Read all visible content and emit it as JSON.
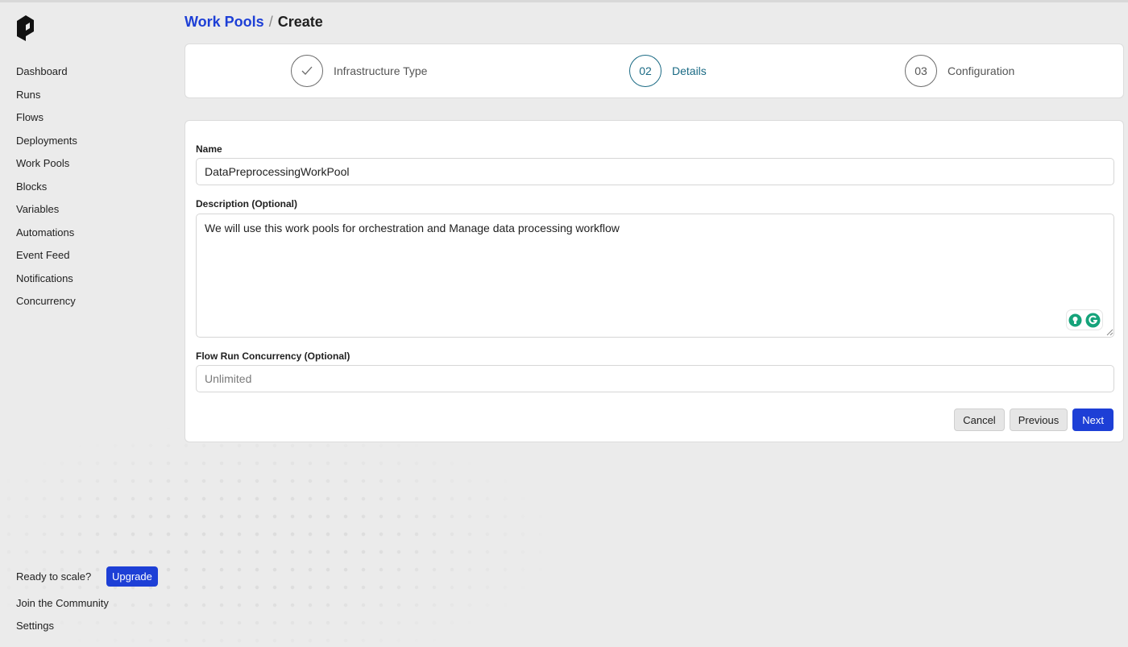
{
  "sidebar": {
    "logo_icon": "prefect-logo-icon",
    "nav_items": [
      {
        "label": "Dashboard"
      },
      {
        "label": "Runs"
      },
      {
        "label": "Flows"
      },
      {
        "label": "Deployments"
      },
      {
        "label": "Work Pools"
      },
      {
        "label": "Blocks"
      },
      {
        "label": "Variables"
      },
      {
        "label": "Automations"
      },
      {
        "label": "Event Feed"
      },
      {
        "label": "Notifications"
      },
      {
        "label": "Concurrency"
      }
    ],
    "ready_text": "Ready to scale?",
    "upgrade_label": "Upgrade",
    "community_label": "Join the Community",
    "settings_label": "Settings"
  },
  "breadcrumb": {
    "parent": "Work Pools",
    "separator": "/",
    "current": "Create"
  },
  "stepper": {
    "steps": [
      {
        "marker": "✓",
        "label": "Infrastructure Type",
        "state": "completed"
      },
      {
        "marker": "02",
        "label": "Details",
        "state": "active"
      },
      {
        "marker": "03",
        "label": "Configuration",
        "state": "pending"
      }
    ]
  },
  "form": {
    "name_label": "Name",
    "name_value": "DataPreprocessingWorkPool",
    "description_label": "Description (Optional)",
    "description_value": "We will use this work pools for orchestration and Manage data processing workflow",
    "concurrency_label": "Flow Run Concurrency (Optional)",
    "concurrency_placeholder": "Unlimited",
    "cancel_label": "Cancel",
    "previous_label": "Previous",
    "next_label": "Next"
  },
  "colors": {
    "accent": "#1d3fd6",
    "step_active": "#1a6a84",
    "background": "#ebebeb",
    "grammarly_green": "#15a37a"
  }
}
